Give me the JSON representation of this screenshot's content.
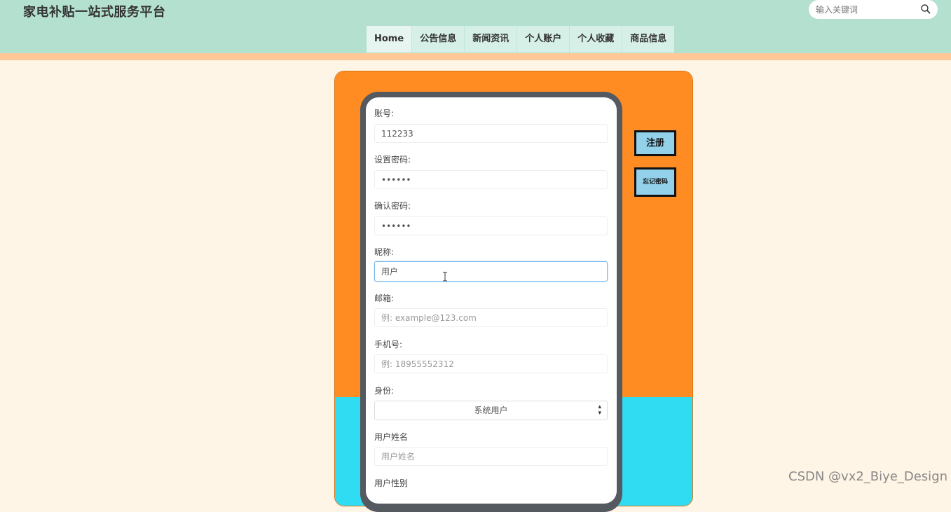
{
  "header": {
    "title": "家电补贴一站式服务平台",
    "search_placeholder": "输入关键词"
  },
  "nav": {
    "items": [
      {
        "label": "Home"
      },
      {
        "label": "公告信息"
      },
      {
        "label": "新闻资讯"
      },
      {
        "label": "个人账户"
      },
      {
        "label": "个人收藏"
      },
      {
        "label": "商品信息"
      }
    ]
  },
  "form": {
    "account_label": "账号:",
    "account_value": "112233",
    "password_label": "设置密码:",
    "password_value": "••••••",
    "confirm_label": "确认密码:",
    "confirm_value": "••••••",
    "nickname_label": "昵称:",
    "nickname_value": "用户",
    "email_label": "邮箱:",
    "email_placeholder": "例: example@123.com",
    "phone_label": "手机号:",
    "phone_placeholder": "例: 18955552312",
    "role_label": "身份:",
    "role_value": "系统用户",
    "username_label": "用户姓名",
    "username_placeholder": "用户姓名",
    "gender_label": "用户性别"
  },
  "actions": {
    "register": "注册",
    "forgot": "忘记密码"
  },
  "watermark": "CSDN @vx2_Biye_Design",
  "colors": {
    "header_bg": "#b3e0cf",
    "stripe": "#ffc896",
    "page_bg": "#fff5e6",
    "panel_orange": "#ff8c22",
    "panel_cyan": "#30dcf2",
    "button_bg": "#93d0ea"
  }
}
